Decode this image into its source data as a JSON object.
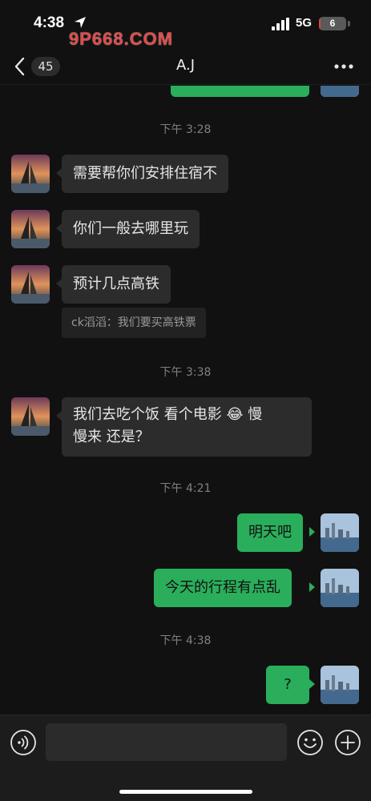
{
  "status": {
    "time": "4:38",
    "network": "5G",
    "battery": "6",
    "battery_level": 0.06,
    "watermark": "9P668.COM"
  },
  "nav": {
    "unread_count": "45",
    "title": "A.J"
  },
  "messages": {
    "ts1": "下午 3:28",
    "m1": "需要帮你们安排住宿不",
    "m2": "你们一般去哪里玩",
    "m3": "预计几点高铁",
    "quote1": "ck滔滔：我们要买高铁票",
    "ts2": "下午 3:38",
    "m4_line1": "我们去吃个饭  看个电影 😂  慢",
    "m4_line2": "慢来 还是？",
    "ts3": "下午 4:21",
    "m5": "明天吧",
    "m6": "今天的行程有点乱",
    "ts4": "下午 4:38",
    "m7": "?"
  },
  "colors": {
    "background": "#111111",
    "incoming_bubble": "#2c2c2c",
    "outgoing_bubble": "#2bae5b",
    "timestamp": "#808080",
    "battery_low": "#e0453d"
  },
  "icons": {
    "back": "chevron-left-icon",
    "more": "more-dots-icon",
    "voice": "voice-icon",
    "emoji": "emoji-icon",
    "plus": "plus-icon"
  }
}
